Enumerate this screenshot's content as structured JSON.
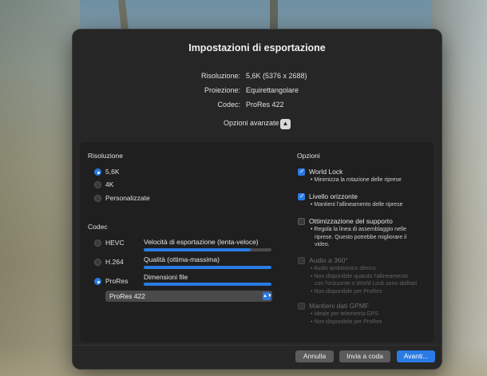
{
  "dialog": {
    "title": "Impostazioni di esportazione",
    "info": [
      {
        "label": "Risoluzione:",
        "value": "5,6K (5376 x 2688)"
      },
      {
        "label": "Proiezione:",
        "value": "Equirettangolare"
      },
      {
        "label": "Codec:",
        "value": "ProRes 422"
      }
    ],
    "advanced_label": "Opzioni avanzate",
    "advanced_icon": "chevron-up-icon"
  },
  "resolution": {
    "heading": "Risoluzione",
    "options": [
      {
        "label": "5,6K",
        "selected": true
      },
      {
        "label": "4K",
        "selected": false
      },
      {
        "label": "Personalizzate",
        "selected": false
      }
    ]
  },
  "codec": {
    "heading": "Codec",
    "options": [
      {
        "label": "HEVC",
        "selected": false
      },
      {
        "label": "H.264",
        "selected": false
      },
      {
        "label": "ProRes",
        "selected": true
      }
    ],
    "sliders": [
      {
        "label": "Velocità di esportazione (lenta-veloce)",
        "value_percent": 84
      },
      {
        "label": "Qualità (ottima-massima)",
        "value_percent": 100
      },
      {
        "label": "Dimensioni file",
        "value_percent": 100
      }
    ],
    "prores_select": "ProRes 422"
  },
  "options": {
    "heading": "Opzioni",
    "items": [
      {
        "label": "World Lock",
        "checked": true,
        "disabled": false,
        "desc": [
          "• Minimizza la rotazione delle riprese"
        ]
      },
      {
        "label": "Livello orizzonte",
        "checked": true,
        "disabled": false,
        "desc": [
          "• Mantieni l'allineamento delle riprese"
        ]
      },
      {
        "label": "Ottimizzazione del supporto",
        "checked": false,
        "disabled": false,
        "desc": [
          "• Regola la linea di assemblaggio nelle",
          "riprese. Questo potrebbe migliorare il",
          "video."
        ]
      },
      {
        "label": "Audio a 360°",
        "checked": false,
        "disabled": true,
        "desc": [
          "• Audio ambisonico sferico",
          "• Non disponibile quando l'allineamento",
          "con l'orizzonte o World Lock sono abilitati",
          "• Non disponibile per ProRes"
        ]
      },
      {
        "label": "Mantieni dati GPMF",
        "checked": false,
        "disabled": true,
        "desc": [
          "• Ideale per telemetria GPS",
          "• Non disponibile per ProRes"
        ]
      }
    ]
  },
  "footer": {
    "cancel": "Annulla",
    "queue": "Invia a coda",
    "next": "Avanti..."
  },
  "colors": {
    "accent": "#2a7be4",
    "dialog_bg": "#262626"
  }
}
